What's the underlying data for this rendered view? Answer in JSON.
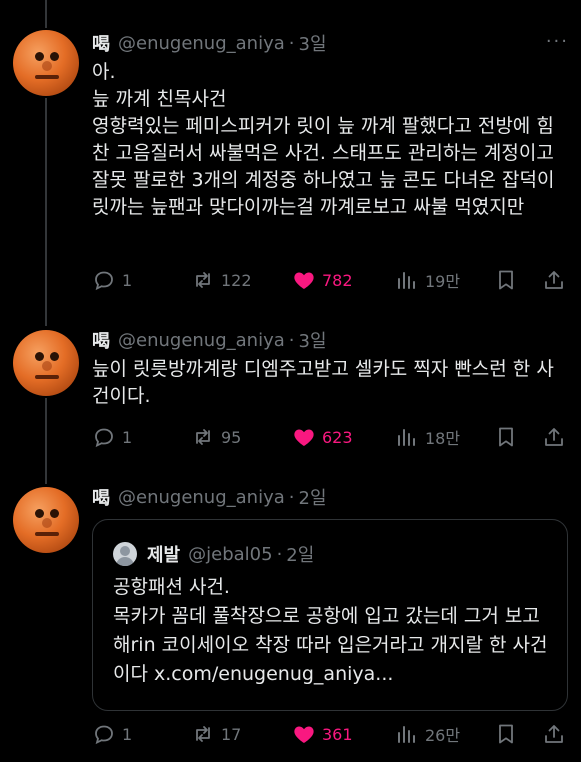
{
  "colors": {
    "background": "#000000",
    "text": "#e7e9ea",
    "muted": "#71767b",
    "like": "#f91880",
    "border": "#2f3336"
  },
  "tweets": [
    {
      "author_name": "喝",
      "handle": "@enugenug_aniya",
      "separator": "·",
      "time": "3일",
      "more": "···",
      "text": "아.\n늪 까계 친목사건\n영향력있는 페미스피커가 릿이 늪 까계 팔했다고 전방에 힘찬 고음질러서 싸불먹은 사건. 스태프도 관리하는 계정이고 잘못 팔로한 3개의 계정중 하나였고 늪 콘도 다녀온 잡덕이 릿까는 늪팬과 맞다이까는걸 까계로보고 싸불 먹였지만",
      "replies": "1",
      "retweets": "122",
      "likes": "782",
      "views": "19만"
    },
    {
      "author_name": "喝",
      "handle": "@enugenug_aniya",
      "separator": "·",
      "time": "3일",
      "more": "",
      "text": "늪이 릿릇방까계랑 디엠주고받고 셀카도 찍자 빤스런 한 사건이다.",
      "replies": "1",
      "retweets": "95",
      "likes": "623",
      "views": "18만"
    },
    {
      "author_name": "喝",
      "handle": "@enugenug_aniya",
      "separator": "·",
      "time": "2일",
      "more": "",
      "quote": {
        "author_name": "제발",
        "handle": "@jebal05",
        "separator": "·",
        "time": "2일",
        "text": "공항패션 사건.\n목카가 꼼데 풀착장으로 공항에 입고 갔는데 그거 보고 해rin 코이세이오 착장 따라 입은거라고 개지랄 한 사건이다 x.com/enugenug_aniya..."
      },
      "replies": "1",
      "retweets": "17",
      "likes": "361",
      "views": "26만"
    }
  ],
  "icons": [
    "reply-icon",
    "retweet-icon",
    "like-icon",
    "views-icon",
    "bookmark-icon",
    "share-icon",
    "more-icon"
  ]
}
